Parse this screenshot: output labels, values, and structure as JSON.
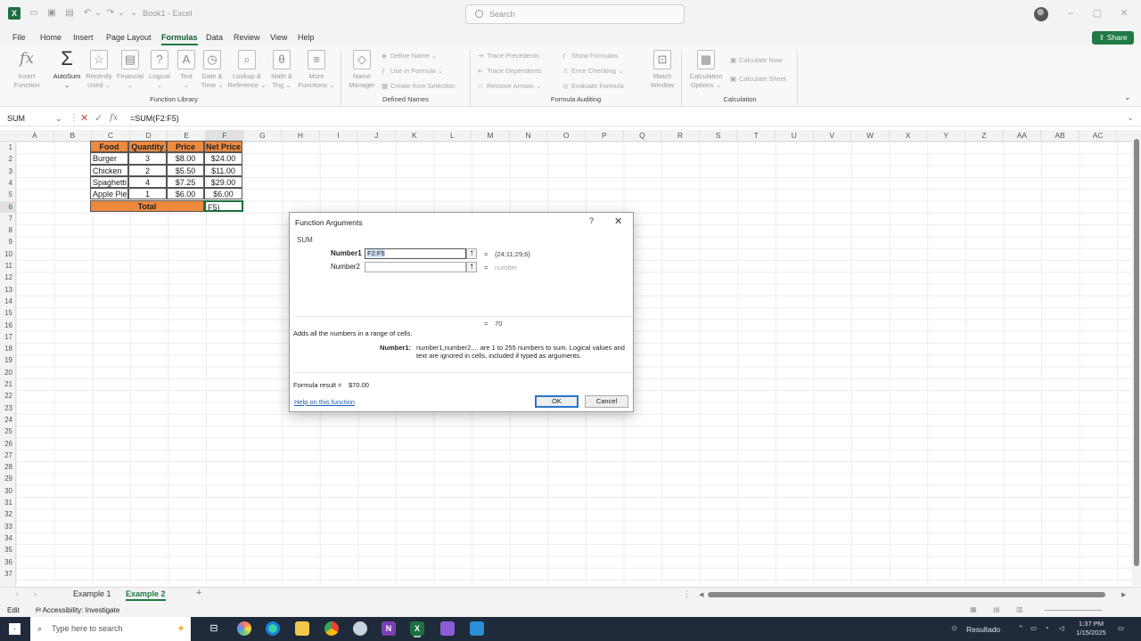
{
  "app": {
    "title": "Book1 - Excel",
    "search_placeholder": "Search",
    "share_label": "Share"
  },
  "menu": [
    "File",
    "Home",
    "Insert",
    "Page Layout",
    "Formulas",
    "Data",
    "Review",
    "View",
    "Help"
  ],
  "menu_active": "Formulas",
  "ribbon": {
    "function_library": {
      "label": "Function Library",
      "buttons": [
        {
          "label": "Insert\nFunction",
          "icon": "fx-icon"
        },
        {
          "label": "AutoSum\n⌄",
          "icon": "sigma-icon"
        },
        {
          "label": "Recently\nUsed ⌄",
          "icon": "star-icon"
        },
        {
          "label": "Financial\n⌄",
          "icon": "book-icon"
        },
        {
          "label": "Logical\n⌄",
          "icon": "question-icon"
        },
        {
          "label": "Text\n⌄",
          "icon": "text-icon"
        },
        {
          "label": "Date &\nTime ⌄",
          "icon": "clock-icon"
        },
        {
          "label": "Lookup &\nReference ⌄",
          "icon": "lookup-icon"
        },
        {
          "label": "Math &\nTrig ⌄",
          "icon": "theta-icon"
        },
        {
          "label": "More\nFunctions ⌄",
          "icon": "more-icon"
        }
      ]
    },
    "defined_names": {
      "label": "Defined Names",
      "name_manager": "Name\nManager",
      "items": [
        "Define Name ⌄",
        "Use in Formula ⌄",
        "Create from Selection"
      ]
    },
    "formula_auditing": {
      "label": "Formula Auditing",
      "items_left": [
        "Trace Precedents",
        "Trace Dependents",
        "Remove Arrows ⌄"
      ],
      "items_right": [
        "Show Formulas",
        "Error Checking ⌄",
        "Evaluate Formula"
      ],
      "watch_window": "Watch\nWindow"
    },
    "calculation": {
      "label": "Calculation",
      "options": "Calculation\nOptions ⌄",
      "items": [
        "Calculate Now",
        "Calculate Sheet"
      ]
    }
  },
  "formula_bar": {
    "name_box": "SUM",
    "formula": "=SUM(F2:F5)"
  },
  "columns": [
    "A",
    "B",
    "C",
    "D",
    "E",
    "F",
    "G",
    "H",
    "I",
    "J",
    "K",
    "L",
    "M",
    "N",
    "O",
    "P",
    "Q",
    "R",
    "S",
    "T",
    "U",
    "V",
    "W",
    "X",
    "Y",
    "Z",
    "AA",
    "AB",
    "AC"
  ],
  "rows": [
    "1",
    "2",
    "3",
    "4",
    "5",
    "6",
    "7",
    "8",
    "9",
    "10",
    "11",
    "12",
    "13",
    "14",
    "15",
    "16",
    "17",
    "18",
    "19",
    "20",
    "21",
    "22",
    "23",
    "24",
    "25",
    "26",
    "27",
    "28",
    "29",
    "30",
    "31",
    "32",
    "33",
    "34",
    "35",
    "36",
    "37"
  ],
  "table": {
    "headers": [
      "Food",
      "Quantity",
      "Price",
      "Net Price"
    ],
    "rows": [
      [
        "Burger",
        "3",
        "$8.00",
        "$24.00"
      ],
      [
        "Chicken",
        "2",
        "$5.50",
        "$11.00"
      ],
      [
        "Spaghetti",
        "4",
        "$7.25",
        "$29.00"
      ],
      [
        "Apple Pie",
        "1",
        "$6.00",
        "$6.00"
      ]
    ],
    "total_label": "Total",
    "total_cell": "F5)"
  },
  "dialog": {
    "title": "Function Arguments",
    "help": "?",
    "close": "✕",
    "function_name": "SUM",
    "arg1_label": "Number1",
    "arg1_value": "F2:F5",
    "arg1_result": "{24;11;29;6}",
    "arg2_label": "Number2",
    "arg2_value": "",
    "arg2_hint": "number",
    "equals": "=",
    "result_value": "70",
    "description": "Adds all the numbers in a range of cells.",
    "arg_desc_label": "Number1:",
    "arg_desc_text": "number1,number2,... are 1 to 255 numbers to sum. Logical values and text are ignored in cells, included if typed as arguments.",
    "formula_result_label": "Formula result =",
    "formula_result_value": "$70.00",
    "help_link": "Help on this function",
    "ok": "OK",
    "cancel": "Cancel"
  },
  "sheet_tabs": [
    "Example 1",
    "Example 2"
  ],
  "active_sheet": "Example 2",
  "status": {
    "mode": "Edit",
    "accessibility": "Accessibility: Investigate"
  },
  "taskbar": {
    "search_placeholder": "Type here to search",
    "weather": "Resultado",
    "time": "1:37 PM",
    "date": "1/15/2025"
  },
  "colors": {
    "accent": "#1f7a44",
    "table_header": "#ee8a3e",
    "taskbar": "#1f2a3a"
  }
}
